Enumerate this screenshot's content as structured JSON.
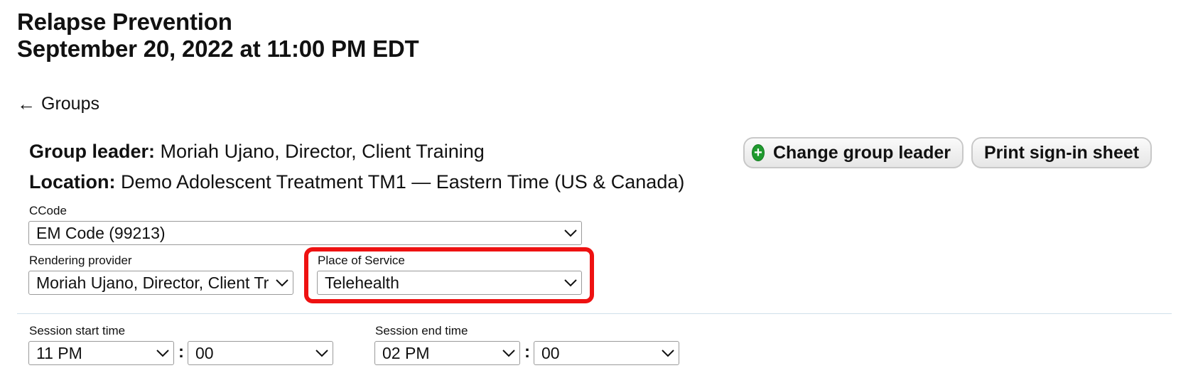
{
  "page": {
    "title_line1": "Relapse Prevention",
    "title_line2": "September 20, 2022 at 11:00 PM EDT"
  },
  "nav": {
    "back_arrow": "←",
    "back_label": "Groups"
  },
  "group_info": {
    "leader_label": "Group leader:",
    "leader_value": "Moriah Ujano, Director, Client Training",
    "location_label": "Location:",
    "location_value": "Demo Adolescent Treatment TM1 — Eastern Time (US & Canada)"
  },
  "actions": {
    "change_leader_label": "Change group leader",
    "change_leader_icon": "plus-circle-icon",
    "print_sheet_label": "Print sign-in sheet"
  },
  "form": {
    "ccode": {
      "label": "CCode",
      "value": "EM Code (99213)"
    },
    "rendering_provider": {
      "label": "Rendering provider",
      "value": "Moriah Ujano, Director, Client Tr"
    },
    "place_of_service": {
      "label": "Place of Service",
      "value": "Telehealth"
    },
    "session_start": {
      "label": "Session start time",
      "hour": "11 PM",
      "separator": ":",
      "minute": "00"
    },
    "session_end": {
      "label": "Session end time",
      "hour": "02 PM",
      "separator": ":",
      "minute": "00"
    }
  },
  "colors": {
    "highlight": "#ee1111",
    "plus_icon": "#1f9a2e"
  }
}
